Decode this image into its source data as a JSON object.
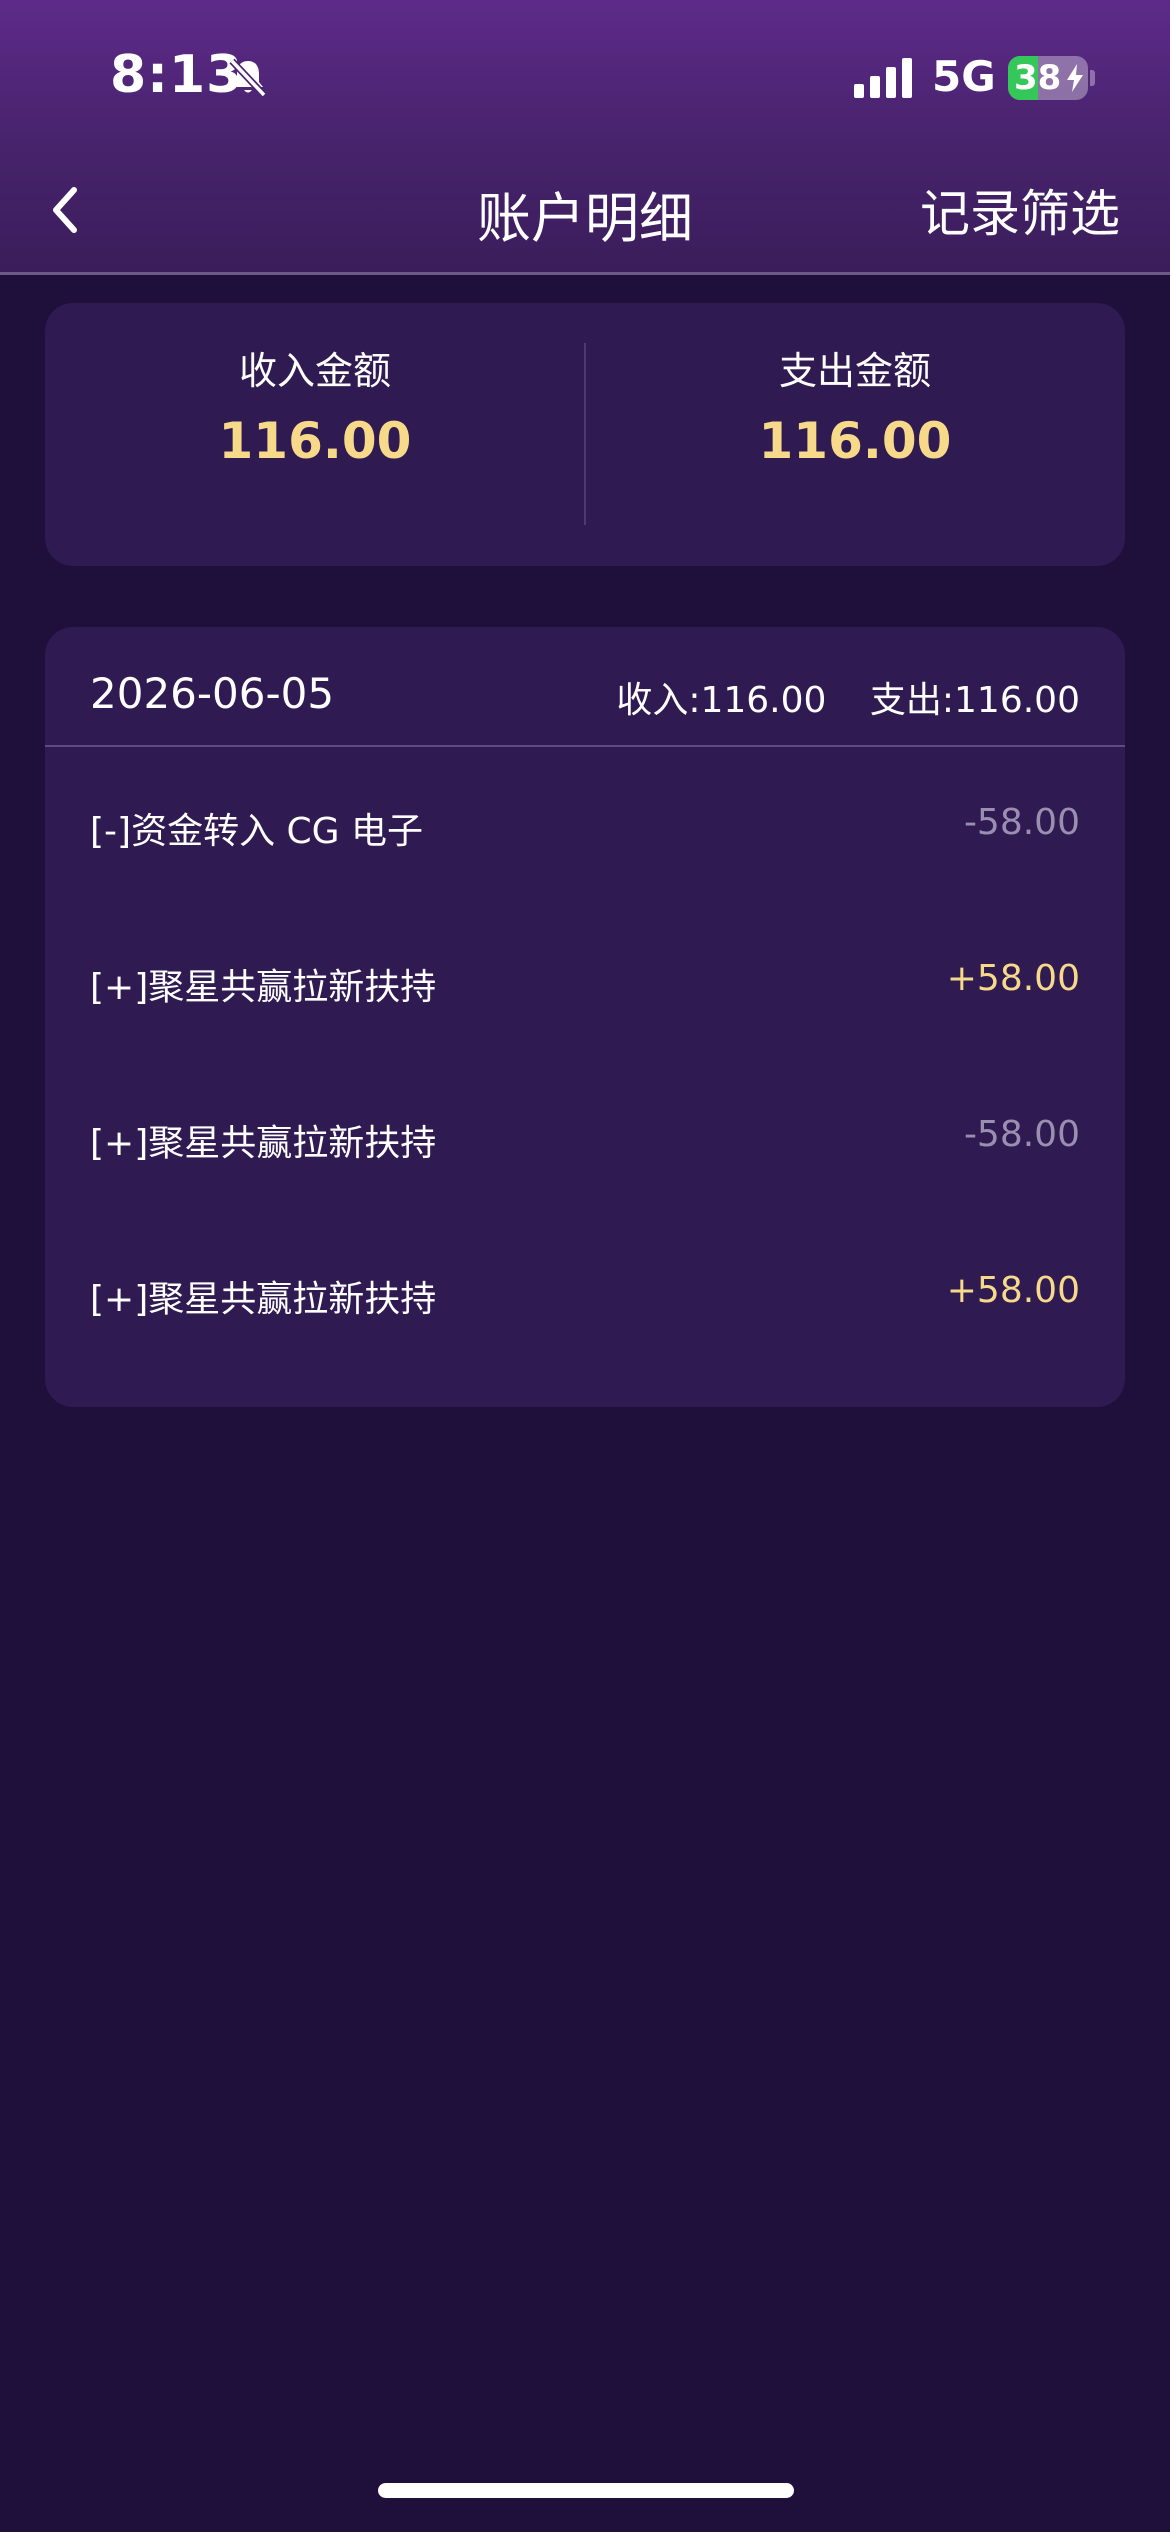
{
  "status_bar": {
    "time": "8:13",
    "network": "5G",
    "battery_level": "38",
    "battery_fraction": 0.38
  },
  "nav": {
    "title": "账户明细",
    "filter_label": "记录筛选"
  },
  "summary": {
    "income_label": "收入金额",
    "income_value": "116.00",
    "expense_label": "支出金额",
    "expense_value": "116.00"
  },
  "detail": {
    "date": "2026-06-05",
    "income_total": "收入:116.00",
    "expense_total": "支出:116.00",
    "rows": [
      {
        "label": "[-]资金转入 CG 电子",
        "amount": "-58.00",
        "type": "neg"
      },
      {
        "label": "[+]聚星共赢拉新扶持",
        "amount": "+58.00",
        "type": "pos"
      },
      {
        "label": "[+]聚星共赢拉新扶持",
        "amount": "-58.00",
        "type": "neg"
      },
      {
        "label": "[+]聚星共赢拉新扶持",
        "amount": "+58.00",
        "type": "pos"
      }
    ]
  },
  "colors": {
    "background": "#1e0f3b",
    "card": "#2f1a52",
    "highlight_amount": "#f7d98a",
    "negative_amount": "#9a8fb0",
    "battery_green": "#35c759"
  },
  "icons": {
    "bell": "bell-slash-icon",
    "signal": "cellular-signal-icon",
    "battery": "battery-charging-icon",
    "back": "chevron-left-icon"
  }
}
